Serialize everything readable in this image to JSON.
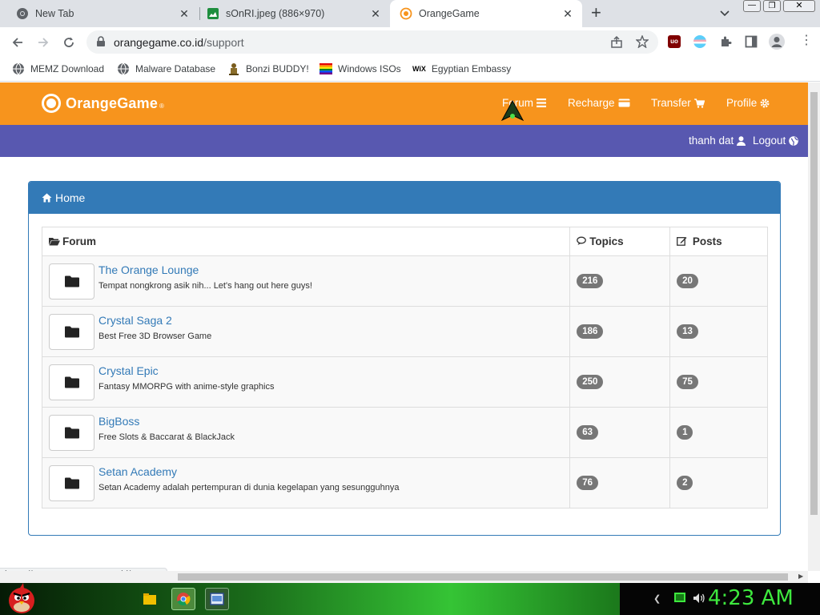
{
  "browser": {
    "tabs": [
      {
        "title": "New Tab",
        "active": false
      },
      {
        "title": "sOnRI.jpeg (886×970)",
        "active": false
      },
      {
        "title": "OrangeGame",
        "active": true
      }
    ],
    "new_tab_symbol": "+",
    "url_domain": "orangegame.co.id",
    "url_path": "/support",
    "bookmarks": [
      {
        "label": "MEMZ Download",
        "icon": "globe-icon"
      },
      {
        "label": "Malware Database",
        "icon": "globe-icon"
      },
      {
        "label": "Bonzi BUDDY!",
        "icon": "bonzi-icon"
      },
      {
        "label": "Windows ISOs",
        "icon": "rainbow-flag-icon"
      },
      {
        "label": "Egyptian Embassy",
        "icon": "wix-icon"
      }
    ],
    "status_url": "https://www.orangegame.co.id/support"
  },
  "site": {
    "logo_text": "OrangeGame",
    "logo_suffix": "®",
    "nav": {
      "forum": "Forum",
      "recharge": "Recharge",
      "transfer": "Transfer",
      "profile": "Profile"
    },
    "user": {
      "name": "thanh dat",
      "logout": "Logout"
    },
    "panel_title": "Home",
    "table": {
      "col_forum": "Forum",
      "col_topics": "Topics",
      "col_posts": "Posts",
      "rows": [
        {
          "name": "The Orange Lounge",
          "desc": "Tempat nongkrong asik nih... Let's hang out here guys!",
          "topics": "216",
          "posts": "20"
        },
        {
          "name": "Crystal Saga 2",
          "desc": "Best Free 3D Browser Game",
          "topics": "186",
          "posts": "13"
        },
        {
          "name": "Crystal Epic",
          "desc": "Fantasy MMORPG with anime-style graphics",
          "topics": "250",
          "posts": "75"
        },
        {
          "name": "BigBoss",
          "desc": "Free Slots & Baccarat & BlackJack",
          "topics": "63",
          "posts": "1"
        },
        {
          "name": "Setan Academy",
          "desc": "Setan Academy adalah pertempuran di dunia kegelapan yang sesungguhnya",
          "topics": "76",
          "posts": "2"
        }
      ]
    }
  },
  "taskbar": {
    "clock": "4:23 AM"
  },
  "colors": {
    "nav_orange": "#f7941d",
    "user_bar": "#5858b0",
    "panel_blue": "#337ab7",
    "badge_gray": "#777777",
    "clock_green": "#3ee83e"
  }
}
